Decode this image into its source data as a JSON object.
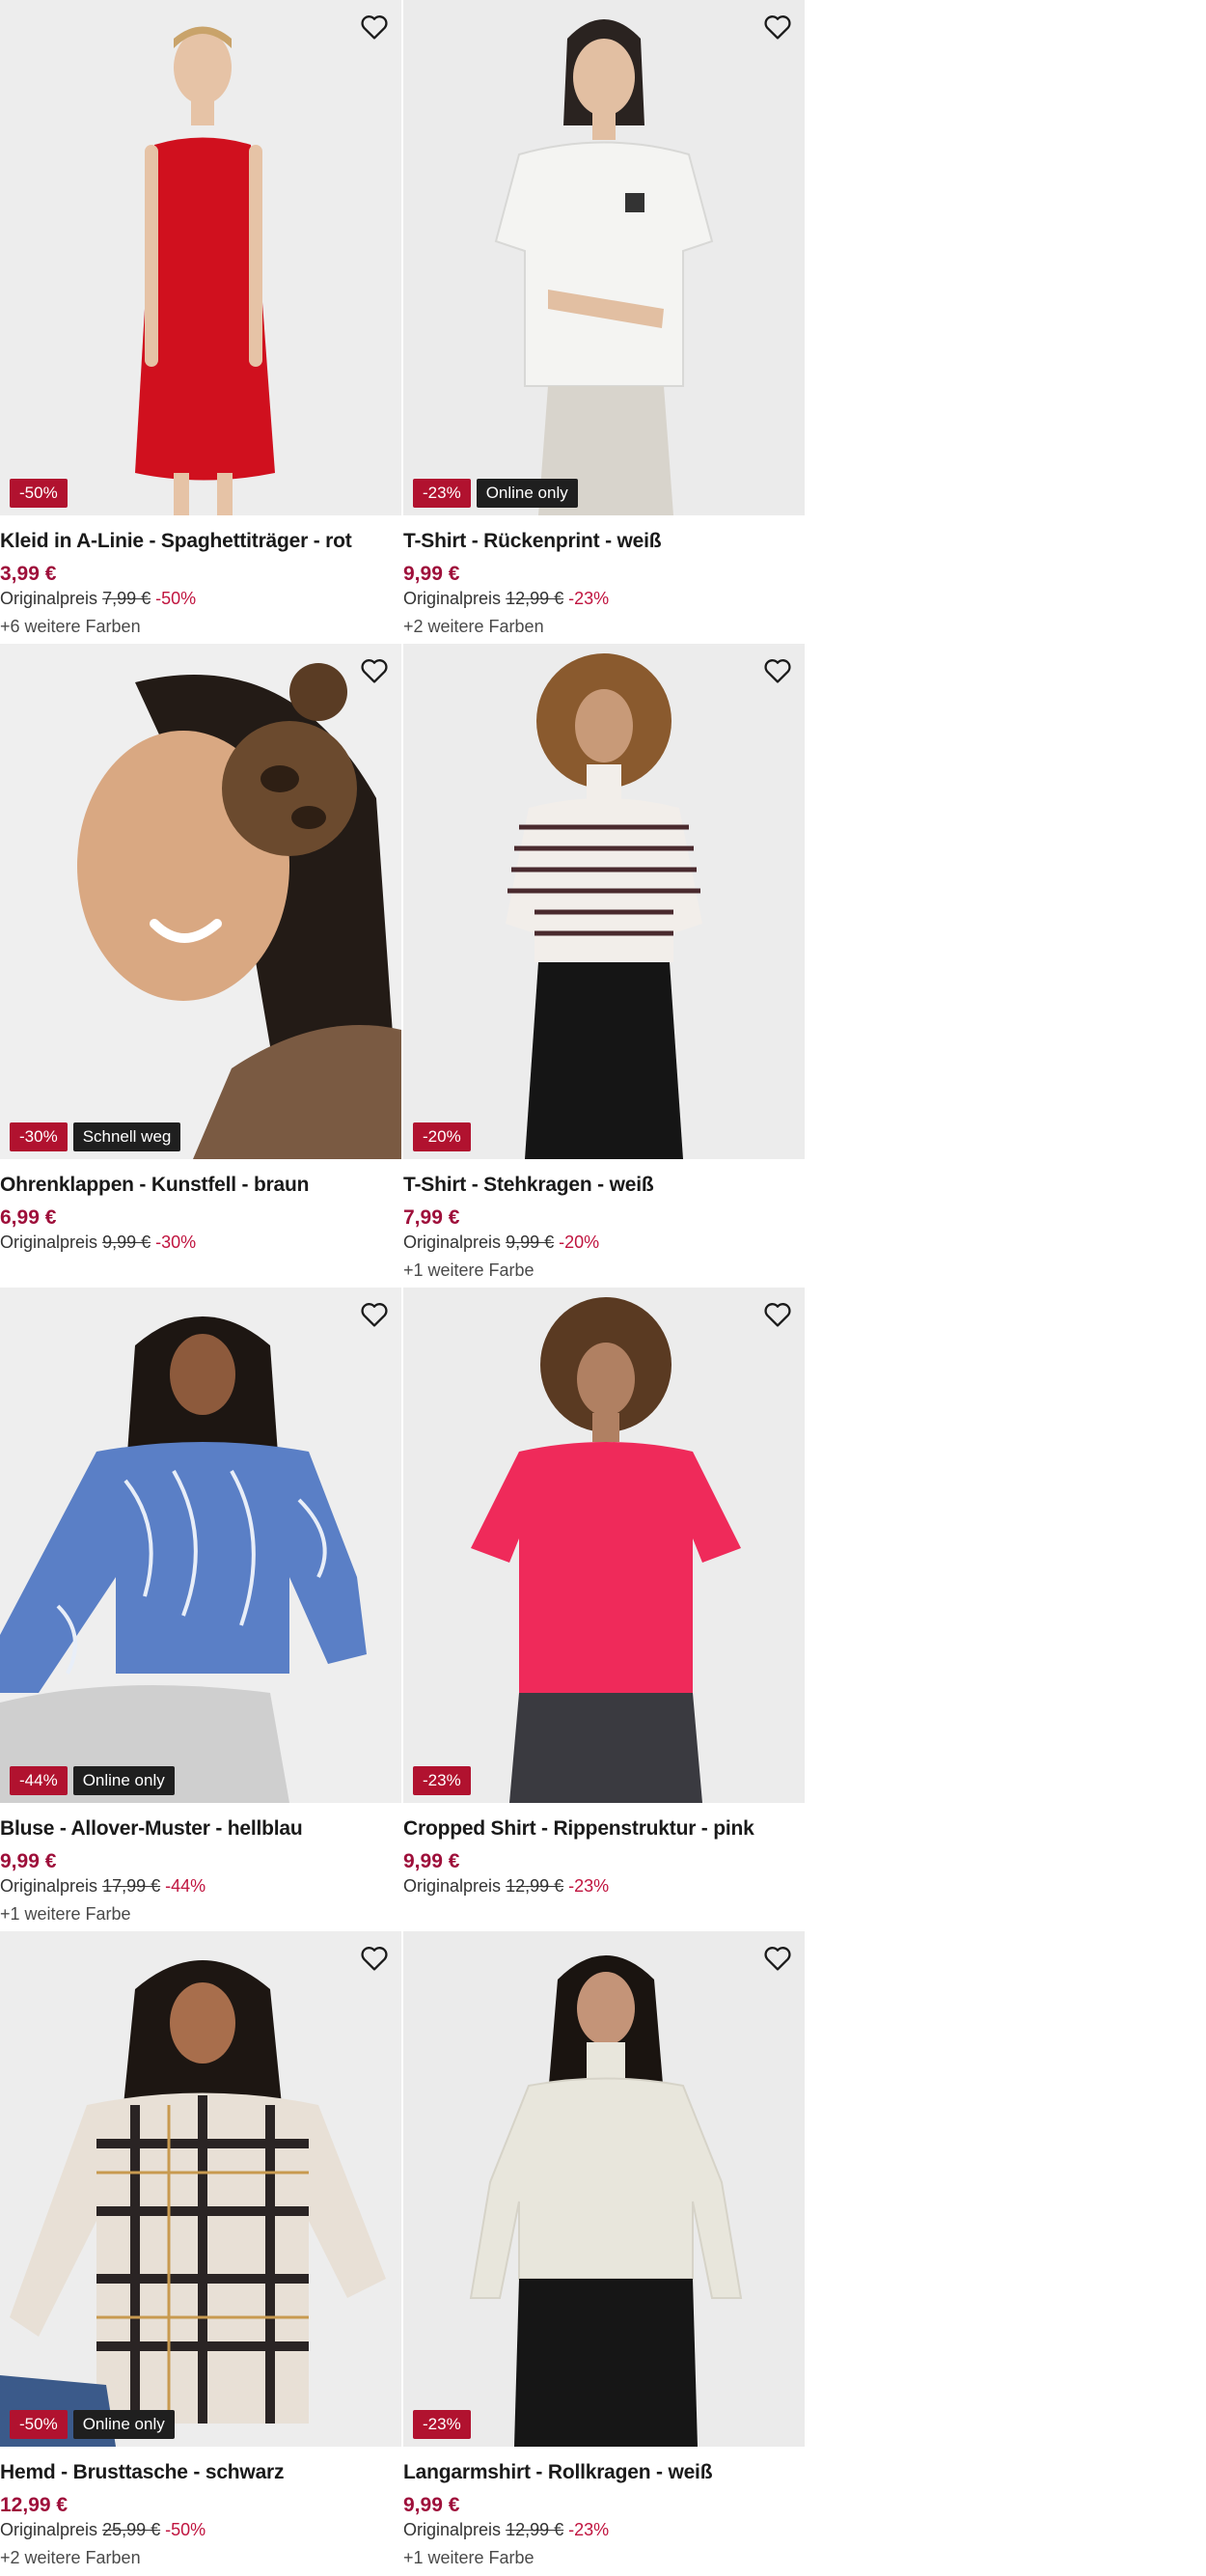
{
  "products": [
    {
      "title": "Kleid in A-Linie - Spaghettiträger - rot",
      "price": "3,99 €",
      "orig_label": "Originalpreis",
      "orig_price": "7,99 €",
      "discount": "-50%",
      "badges": [
        "-50%"
      ],
      "colors": "+6 weitere Farben",
      "garment_color": "#d0101e",
      "favorite_icon": "heart-outline-icon"
    },
    {
      "title": "T-Shirt - Rückenprint - weiß",
      "price": "9,99 €",
      "orig_label": "Originalpreis",
      "orig_price": "12,99 €",
      "discount": "-23%",
      "badges": [
        "-23%",
        "Online only"
      ],
      "colors": "+2 weitere Farben",
      "garment_color": "#f4f4f2",
      "favorite_icon": "heart-outline-icon"
    },
    {
      "title": "Ohrenklappen - Kunstfell - braun",
      "price": "6,99 €",
      "orig_label": "Originalpreis",
      "orig_price": "9,99 €",
      "discount": "-30%",
      "badges": [
        "-30%",
        "Schnell weg"
      ],
      "colors": "",
      "garment_color": "#6b4a2e",
      "favorite_icon": "heart-outline-icon"
    },
    {
      "title": "T-Shirt - Stehkragen - weiß",
      "price": "7,99 €",
      "orig_label": "Originalpreis",
      "orig_price": "9,99 €",
      "discount": "-20%",
      "badges": [
        "-20%"
      ],
      "colors": "+1 weitere Farbe",
      "garment_color": "#f2eeea",
      "favorite_icon": "heart-outline-icon"
    },
    {
      "title": "Bluse - Allover-Muster - hellblau",
      "price": "9,99 €",
      "orig_label": "Originalpreis",
      "orig_price": "17,99 €",
      "discount": "-44%",
      "badges": [
        "-44%",
        "Online only"
      ],
      "colors": "+1 weitere Farbe",
      "garment_color": "#5a7fc6",
      "favorite_icon": "heart-outline-icon"
    },
    {
      "title": "Cropped Shirt - Rippenstruktur - pink",
      "price": "9,99 €",
      "orig_label": "Originalpreis",
      "orig_price": "12,99 €",
      "discount": "-23%",
      "badges": [
        "-23%"
      ],
      "colors": "",
      "garment_color": "#ef2a5a",
      "favorite_icon": "heart-outline-icon"
    },
    {
      "title": "Hemd - Brusttasche - schwarz",
      "price": "12,99 €",
      "orig_label": "Originalpreis",
      "orig_price": "25,99 €",
      "discount": "-50%",
      "badges": [
        "-50%",
        "Online only"
      ],
      "colors": "+2 weitere Farben",
      "garment_color": "#3a3535",
      "favorite_icon": "heart-outline-icon"
    },
    {
      "title": "Langarmshirt - Rollkragen - weiß",
      "price": "9,99 €",
      "orig_label": "Originalpreis",
      "orig_price": "12,99 €",
      "discount": "-23%",
      "badges": [
        "-23%"
      ],
      "colors": "+1 weitere Farbe",
      "garment_color": "#e8e6dc",
      "favorite_icon": "heart-outline-icon"
    }
  ],
  "theme": {
    "price_color": "#9e0f3a",
    "discount_badge_color": "#b1122f",
    "flag_badge_color": "#1f1f1f"
  }
}
